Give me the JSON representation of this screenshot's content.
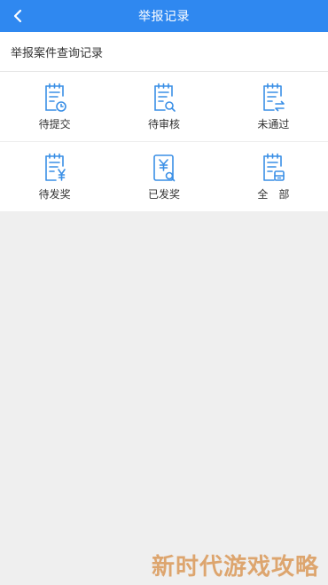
{
  "header": {
    "title": "举报记录"
  },
  "subheader": {
    "title": "举报案件查询记录"
  },
  "tiles": [
    {
      "label": "待提交",
      "icon": "clock-doc-icon"
    },
    {
      "label": "待审核",
      "icon": "search-doc-icon"
    },
    {
      "label": "未通过",
      "icon": "exchange-doc-icon"
    },
    {
      "label": "待发奖",
      "icon": "yen-doc-icon"
    },
    {
      "label": "已发奖",
      "icon": "yen-search-doc-icon"
    },
    {
      "label": "全　部",
      "icon": "archive-doc-icon"
    }
  ],
  "watermark": "新时代游戏攻略",
  "colors": {
    "accent": "#2f88f0",
    "icon": "#3a8fe6",
    "background": "#efefef"
  }
}
